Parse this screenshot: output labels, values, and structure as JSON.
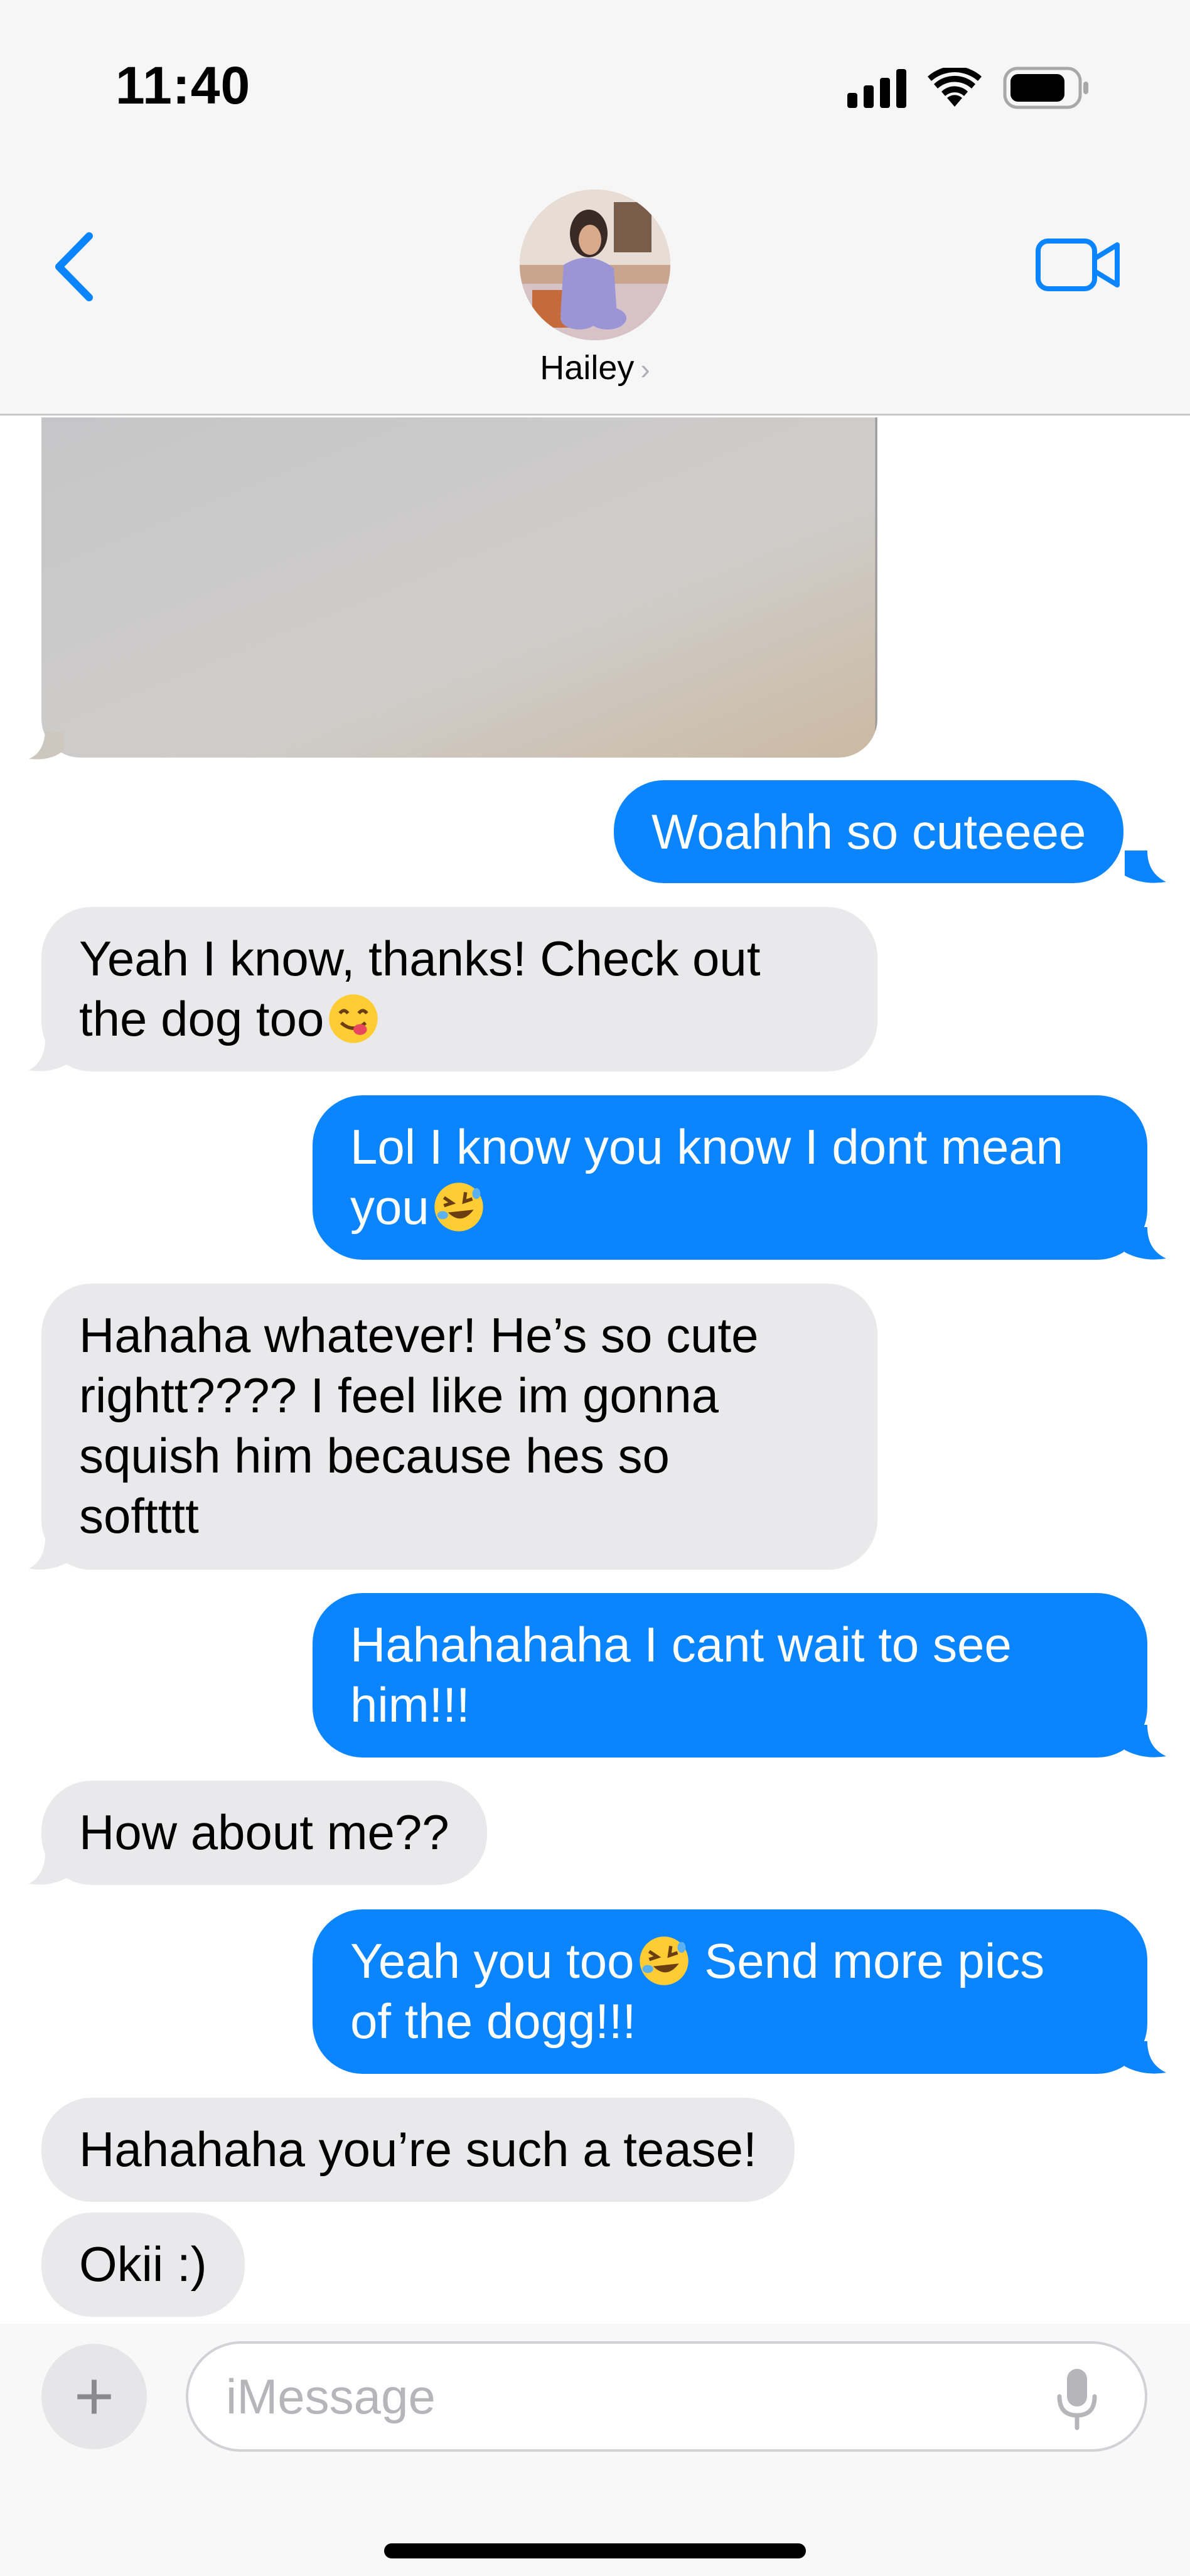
{
  "status_bar": {
    "time": "11:40",
    "icons": [
      "signal-icon",
      "wifi-icon",
      "battery-icon"
    ]
  },
  "header": {
    "back_icon": "chevron-left-icon",
    "contact_name": "Hailey",
    "name_chevron": "›",
    "video_icon": "video-camera-icon"
  },
  "colors": {
    "outgoing_bubble": "#0a84ff",
    "incoming_bubble": "#e9e9eb",
    "accent": "#0a84ff"
  },
  "messages": [
    {
      "direction": "in",
      "type": "photo"
    },
    {
      "direction": "out",
      "text": "Woahhh so cuteeee"
    },
    {
      "direction": "in",
      "lines": [
        "Yeah I know, thanks! Check out",
        "the dog too"
      ],
      "emoji": "face-savoring-food-emoji"
    },
    {
      "direction": "out",
      "lines": [
        "Lol I know you know I dont mean",
        "you"
      ],
      "emoji": "rolling-on-floor-laughing-emoji"
    },
    {
      "direction": "in",
      "lines": [
        "Hahaha whatever! He’s so cute",
        "rightt???? I feel like im gonna",
        "squish him because hes so",
        "softttt"
      ]
    },
    {
      "direction": "out",
      "lines": [
        "Hahahahaha I cant wait to see",
        "him!!!"
      ]
    },
    {
      "direction": "in",
      "text": "How about me??"
    },
    {
      "direction": "out",
      "lines_a": "Yeah you too",
      "lines_b": " Send more pics",
      "line2": "of the dogg!!!",
      "emoji": "rolling-on-floor-laughing-emoji"
    },
    {
      "direction": "in",
      "text": "Hahahaha you’re such a tease!"
    },
    {
      "direction": "in",
      "text": "Okii :)"
    }
  ],
  "input_bar": {
    "plus_label": "+",
    "placeholder": "iMessage",
    "mic_icon": "microphone-icon"
  }
}
